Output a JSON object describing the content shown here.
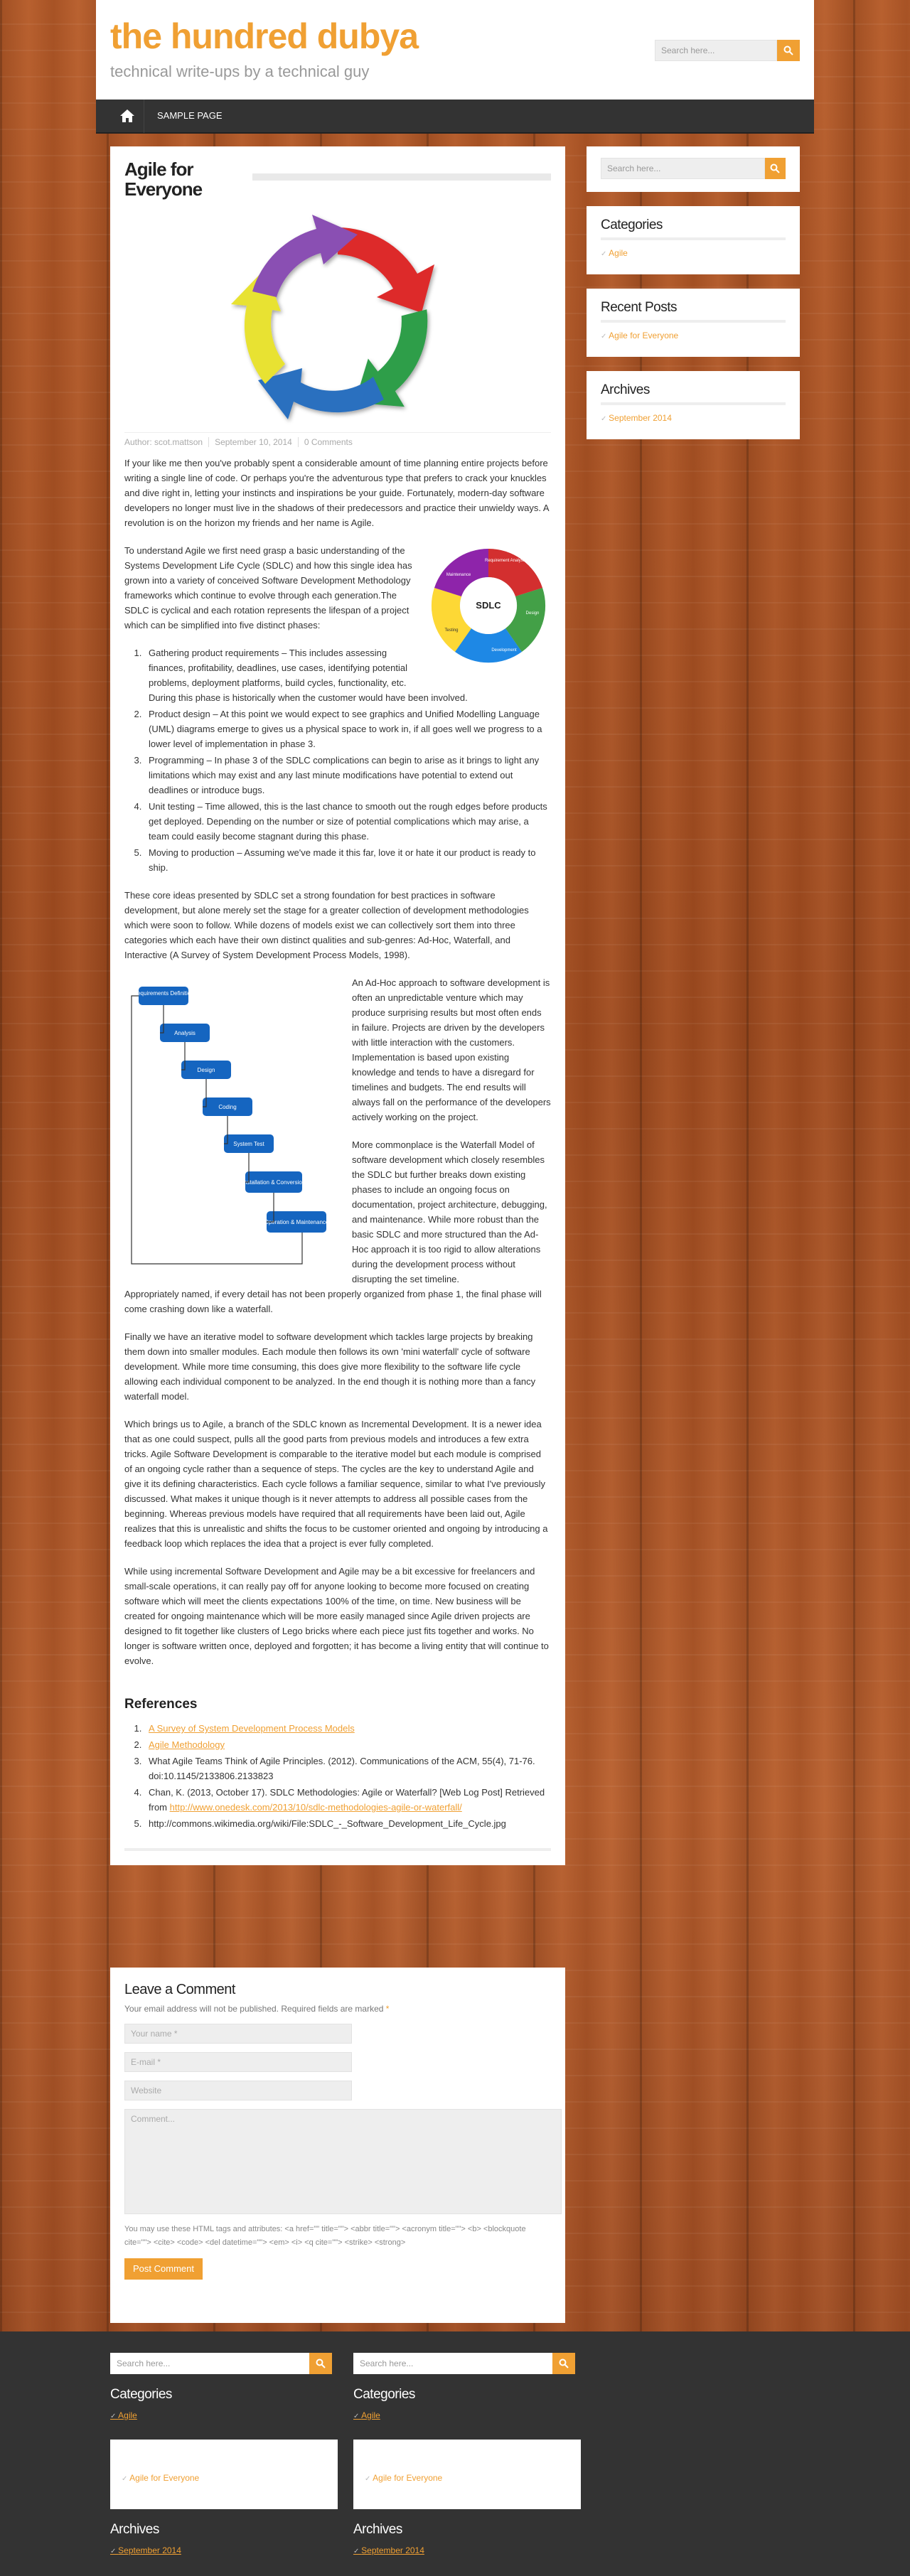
{
  "site": {
    "title": "the hundred dubya",
    "description": "technical write-ups by a technical guy"
  },
  "search": {
    "placeholder": "Search here..."
  },
  "nav": {
    "items": [
      "SAMPLE PAGE"
    ]
  },
  "post": {
    "title": "Agile for Everyone",
    "meta": {
      "author": "Author: scot.mattson",
      "date": "September 10, 2014",
      "comments": "0 Comments"
    },
    "p1": "If your like me then you've probably spent a considerable amount of time planning entire projects before writing a single line of code. Or perhaps you're the adventurous type that prefers to crack your knuckles and dive right in, letting your instincts and inspirations be your guide. Fortunately, modern-day software developers no longer must live in the shadows of their predecessors and practice their unwieldy ways. A revolution is on the horizon my friends and her name is Agile.",
    "p2": "To understand Agile we first need grasp a basic understanding of the Systems Development Life Cycle (SDLC) and how this single idea has grown into a variety of conceived Software Development Methodology frameworks which continue to evolve through each generation.The SDLC is cyclical and each rotation represents the lifespan of a project which can be simplified into five distinct phases:",
    "phases": [
      "Gathering product requirements – This includes assessing finances, profitability, deadlines, use cases, identifying potential problems, deployment platforms, build cycles, functionality, etc. During this phase is historically when the customer would have been involved.",
      "Product design – At this point we would expect to see graphics and Unified Modelling Language (UML) diagrams emerge to gives us a physical space to work in, if all goes well we progress to a lower level of implementation in phase 3.",
      "Programming – In phase 3 of the SDLC complications can begin to arise as it brings to light any limitations which may exist and any last minute modifications have potential to extend out deadlines or introduce bugs.",
      "Unit testing – Time allowed, this is the last chance to smooth out the rough edges before products get deployed. Depending on the number or size of potential complications which may arise, a team could easily become stagnant during this phase.",
      "Moving to production – Assuming we've made it this far, love it or hate it our product is ready to ship."
    ],
    "p3": "These core ideas presented by SDLC set a strong foundation for best practices in software development, but alone merely set the stage for a greater collection of development methodologies which were soon to follow. While dozens of models exist we can collectively sort them into three categories which each have their own distinct qualities and sub-genres: Ad-Hoc, Waterfall, and Interactive (A Survey of System Development Process Models, 1998).",
    "p4": "An Ad-Hoc approach to software development is often an unpredictable venture which may produce surprising results but most often ends in failure. Projects are driven by the developers with little interaction with the customers. Implementation is based upon existing knowledge and tends to have a disregard for timelines and budgets. The end results will always fall on the performance of the developers actively working on the project.",
    "p5a": "More commonplace is the Waterfall Model of software development which closely resembles the SDLC but further breaks down existing phases to include an ongoing focus on documentation, project architecture, debugging, and maintenance. While more robust than the basic SDLC and more structured than the Ad-Hoc approach it is too rigid to allow alterations during the development process without disrupting the set timeline.",
    "p5b": "Appropriately named, if every detail has not been properly organized from phase 1, the final phase will come crashing down like a waterfall.",
    "p6": "Finally we have an iterative model to software development which tackles large projects by breaking them down into smaller modules. Each module then follows its own 'mini waterfall' cycle of software development. While more time consuming, this does give more flexibility to the software life cycle allowing each individual component to be analyzed. In the end though it is nothing more than a fancy waterfall model.",
    "p7": "Which brings us to Agile, a branch of the SDLC known as Incremental Development. It is a newer idea that as one could suspect, pulls all the good parts from previous models and introduces a few extra tricks. Agile Software Development is comparable to the iterative model but each module is comprised of an ongoing cycle rather than a sequence of steps. The cycles are the key to understand Agile and give it its defining characteristics. Each cycle follows a familiar sequence, similar to what I've previously discussed. What makes it unique though is it never attempts to address all possible cases from the beginning. Whereas previous models have required that all requirements have been laid out, Agile realizes that this is unrealistic and shifts the focus to be customer oriented and ongoing by introducing a feedback loop which replaces the idea that a project is ever fully completed.",
    "p8": "While using incremental Software Development and Agile may be a bit excessive for freelancers and small-scale operations, it can really pay off for anyone looking to become more focused on creating software which will meet the clients expectations 100% of the time, on time. New business will be created for ongoing maintenance which will be more easily managed since Agile driven projects are designed to fit together like clusters of Lego bricks where each piece just fits together and works. No longer is software written once, deployed and forgotten; it has become a living entity that will continue to evolve.",
    "sdlc_diagram": {
      "center": "SDLC",
      "labels": [
        "Requirement Analysis",
        "Design",
        "Development",
        "Testing",
        "Maintenance"
      ]
    },
    "waterfall_steps": [
      "Requirements Definition",
      "Analysis",
      "Design",
      "Coding",
      "System Test",
      "Installation & Conversion",
      "Operation & Maintenance"
    ],
    "references_title": "References",
    "references": [
      {
        "text": "A Survey of System Development Process Models",
        "link": true
      },
      {
        "text": "Agile Methodology",
        "link": true
      },
      {
        "text": "What Agile Teams Think of Agile Principles. (2012). Communications of the ACM, 55(4), 71-76. doi:10.1145/2133806.2133823",
        "link": false
      },
      {
        "pre": "Chan, K. (2013, October 17). SDLC Methodologies: Agile or Waterfall? [Web Log Post] Retrieved from ",
        "url": "http://www.onedesk.com/2013/10/sdlc-methodologies-agile-or-waterfall/"
      },
      {
        "text": "http://commons.wikimedia.org/wiki/File:SDLC_-_Software_Development_Life_Cycle.jpg",
        "link": false
      }
    ]
  },
  "sidebar": {
    "categories_title": "Categories",
    "categories": [
      "Agile"
    ],
    "recent_title": "Recent Posts",
    "recent": [
      "Agile for Everyone"
    ],
    "archives_title": "Archives",
    "archives": [
      "September 2014"
    ]
  },
  "comment": {
    "title": "Leave a Comment",
    "note": "Your email address will not be published. Required fields are marked ",
    "req": "*",
    "name": "Your name *",
    "email": "E-mail *",
    "website": "Website",
    "message": "Comment...",
    "tags": "You may use these HTML tags and attributes: <a href=\"\" title=\"\"> <abbr title=\"\"> <acronym title=\"\"> <b> <blockquote cite=\"\"> <cite> <code> <del datetime=\"\"> <em> <i> <q cite=\"\"> <strike> <strong>",
    "button": "Post Comment"
  },
  "colors": {
    "accent": "#f0a033",
    "dark": "#333333"
  }
}
